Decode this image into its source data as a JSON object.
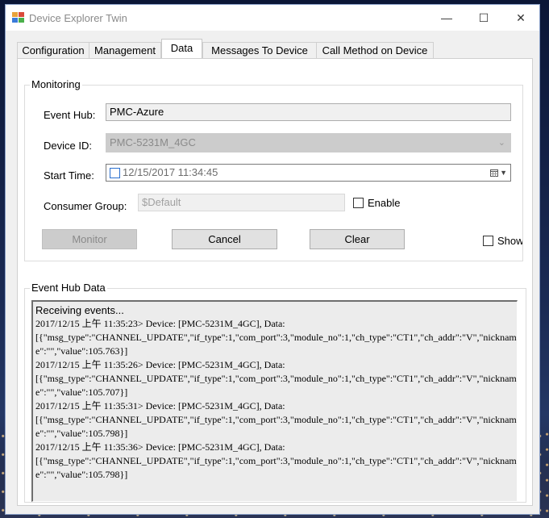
{
  "window": {
    "title": "Device Explorer Twin",
    "min_glyph": "—",
    "max_glyph": "☐",
    "close_glyph": "✕"
  },
  "tabs": [
    {
      "label": "Configuration"
    },
    {
      "label": "Management"
    },
    {
      "label": "Data",
      "active": true
    },
    {
      "label": "Messages To Device"
    },
    {
      "label": "Call Method on Device"
    }
  ],
  "monitoring": {
    "group_label": "Monitoring",
    "event_hub_label": "Event Hub:",
    "event_hub_value": "PMC-Azure",
    "device_id_label": "Device ID:",
    "device_id_value": "PMC-5231M_4GC",
    "start_time_label": "Start Time:",
    "start_time_value": "12/15/2017 11:34:45",
    "consumer_group_label": "Consumer Group:",
    "consumer_group_value": "$Default",
    "enable_label": "Enable",
    "monitor_button": "Monitor",
    "cancel_button": "Cancel",
    "clear_button": "Clear",
    "show_label": "Show s"
  },
  "event_hub_data": {
    "group_label": "Event Hub Data",
    "lines": [
      "Receiving events...",
      "2017/12/15 上午 11:35:23> Device: [PMC-5231M_4GC], Data:",
      "[{\"msg_type\":\"CHANNEL_UPDATE\",\"if_type\":1,\"com_port\":3,\"module_no\":1,\"ch_type\":\"CT1\",\"ch_addr\":\"V\",\"nicknam",
      "e\":\"\",\"value\":105.763}]",
      "2017/12/15 上午 11:35:26> Device: [PMC-5231M_4GC], Data:",
      "[{\"msg_type\":\"CHANNEL_UPDATE\",\"if_type\":1,\"com_port\":3,\"module_no\":1,\"ch_type\":\"CT1\",\"ch_addr\":\"V\",\"nicknam",
      "e\":\"\",\"value\":105.707}]",
      "2017/12/15 上午 11:35:31> Device: [PMC-5231M_4GC], Data:",
      "[{\"msg_type\":\"CHANNEL_UPDATE\",\"if_type\":1,\"com_port\":3,\"module_no\":1,\"ch_type\":\"CT1\",\"ch_addr\":\"V\",\"nicknam",
      "e\":\"\",\"value\":105.798}]",
      "2017/12/15 上午 11:35:36> Device: [PMC-5231M_4GC], Data:",
      "[{\"msg_type\":\"CHANNEL_UPDATE\",\"if_type\":1,\"com_port\":3,\"module_no\":1,\"ch_type\":\"CT1\",\"ch_addr\":\"V\",\"nicknam",
      "e\":\"\",\"value\":105.798}]"
    ]
  }
}
